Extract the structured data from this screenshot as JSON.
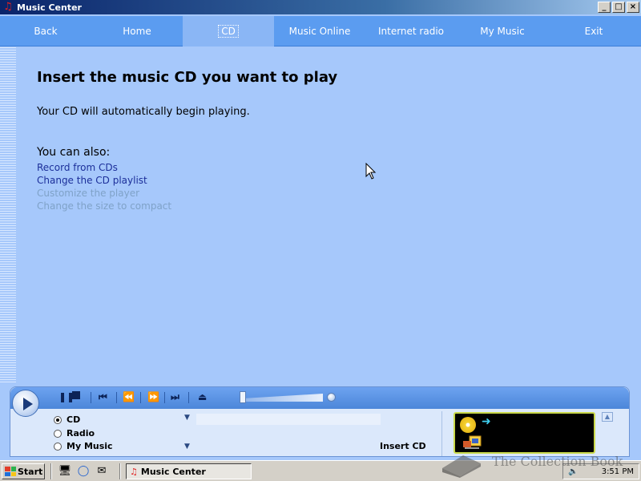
{
  "window": {
    "title": "Music Center",
    "controls": [
      "_",
      "□",
      "×"
    ]
  },
  "nav": {
    "items": [
      {
        "label": "Back"
      },
      {
        "label": "Home"
      },
      {
        "label": "CD",
        "active": true
      },
      {
        "label": "Music Online"
      },
      {
        "label": "Internet radio"
      },
      {
        "label": "My Music"
      },
      {
        "label": "Exit"
      }
    ]
  },
  "main": {
    "heading": "Insert the music CD you want to play",
    "subtext": "Your CD will automatically begin playing.",
    "also_label": "You can also:",
    "links": [
      {
        "label": "Record from CDs",
        "enabled": true
      },
      {
        "label": "Change the CD playlist",
        "enabled": true
      },
      {
        "label": "Customize the player",
        "enabled": false
      },
      {
        "label": "Change the size to compact",
        "enabled": false
      }
    ]
  },
  "player": {
    "sources": [
      {
        "label": "CD",
        "selected": true
      },
      {
        "label": "Radio",
        "selected": false
      },
      {
        "label": "My Music",
        "selected": false
      }
    ],
    "status": "Insert CD",
    "icons": [
      "play-icon",
      "pause-icon",
      "stop-icon",
      "previous-track-icon",
      "rewind-icon",
      "fast-forward-icon",
      "next-track-icon",
      "eject-icon"
    ]
  },
  "taskbar": {
    "start_label": "Start",
    "task_label": "Music Center",
    "clock": "3:51 PM"
  },
  "watermark": {
    "text": "The Collection Book"
  },
  "colors": {
    "background": "#a6c8fb",
    "nav": "#5b9cf0",
    "link": "#1c2f9a",
    "link_disabled": "#7fa2c8"
  }
}
